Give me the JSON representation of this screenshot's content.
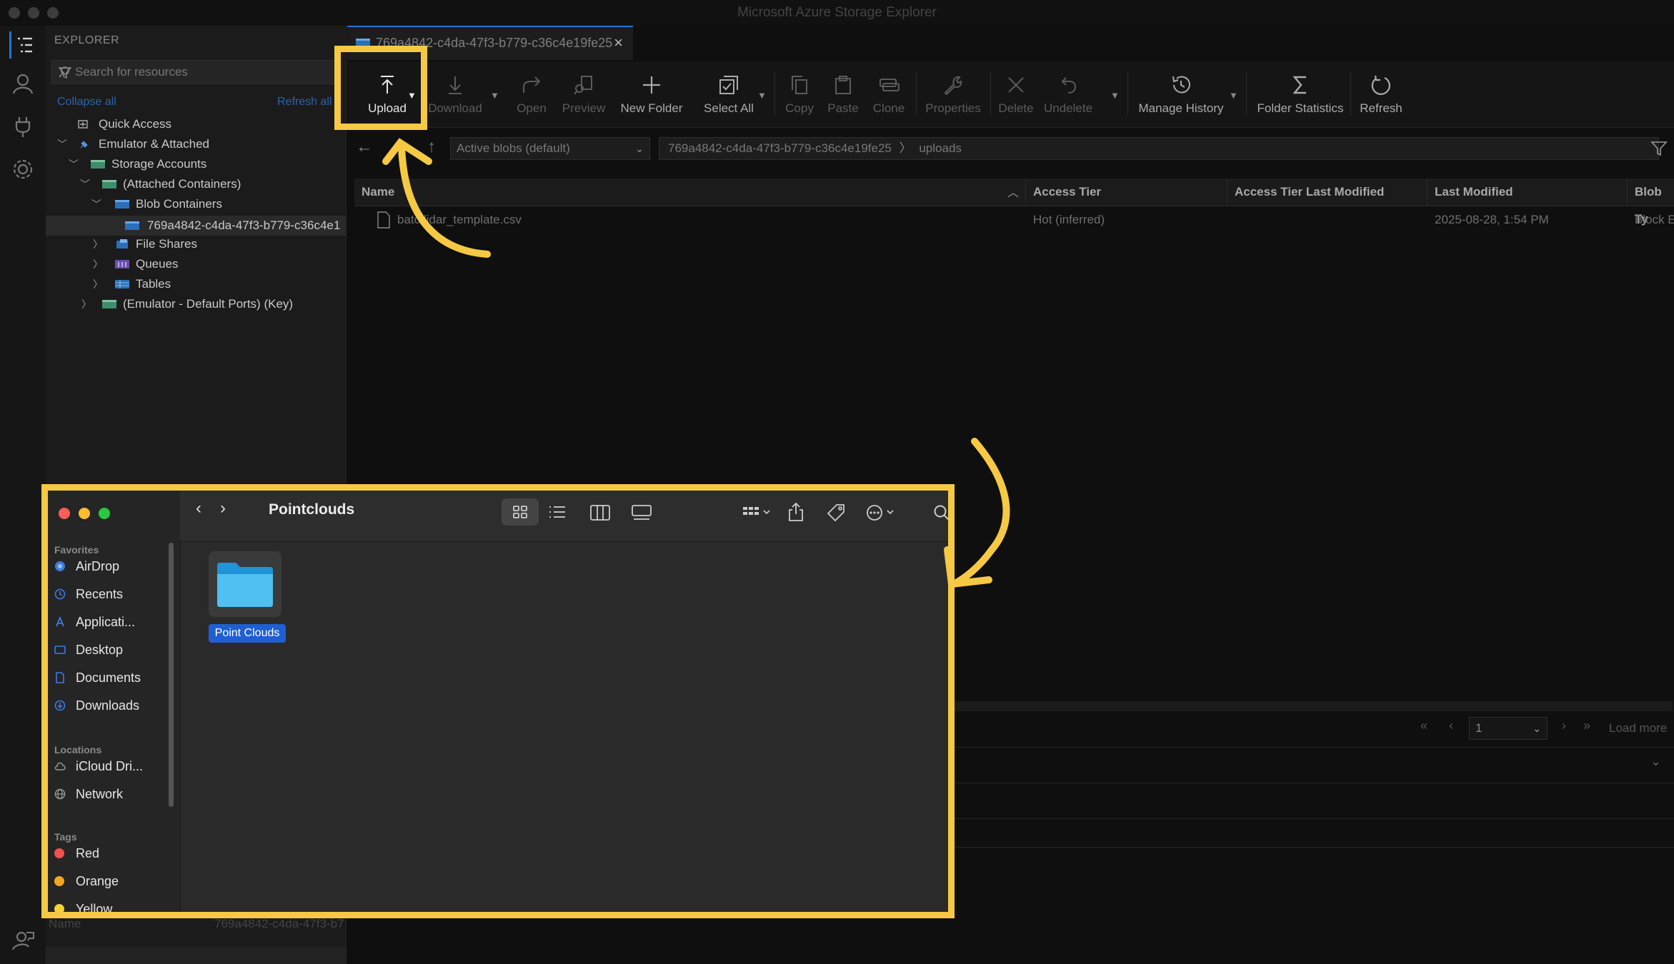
{
  "window": {
    "title": "Microsoft Azure Storage Explorer"
  },
  "explorer": {
    "title": "EXPLORER",
    "search_placeholder": "Search for resources",
    "collapse_all": "Collapse all",
    "refresh_all": "Refresh all",
    "tree": {
      "quick_access": "Quick Access",
      "emulator_attached": "Emulator & Attached",
      "storage_accounts": "Storage Accounts",
      "attached_containers": "(Attached Containers)",
      "blob_containers": "Blob Containers",
      "container_id": "769a4842-c4da-47f3-b779-c36c4e1",
      "file_shares": "File Shares",
      "queues": "Queues",
      "tables": "Tables",
      "emulator_default": "(Emulator - Default Ports) (Key)"
    },
    "bottom_name_label": "Name",
    "bottom_name_value": "769a4842-c4da-47f3-b7"
  },
  "tab": {
    "label": "769a4842-c4da-47f3-b779-c36c4e19fe25"
  },
  "toolbar": {
    "upload": "Upload",
    "download": "Download",
    "open": "Open",
    "preview": "Preview",
    "new_folder": "New Folder",
    "select_all": "Select All",
    "copy": "Copy",
    "paste": "Paste",
    "clone": "Clone",
    "properties": "Properties",
    "delete": "Delete",
    "undelete": "Undelete",
    "manage_history": "Manage History",
    "folder_statistics": "Folder Statistics",
    "refresh": "Refresh"
  },
  "navbar": {
    "view_mode": "Active blobs (default)",
    "breadcrumb_container": "769a4842-c4da-47f3-b779-c36c4e19fe25",
    "breadcrumb_folder": "uploads"
  },
  "grid": {
    "columns": [
      "Name",
      "Access Tier",
      "Access Tier Last Modified",
      "Last Modified",
      "Blob Ty"
    ],
    "rows": [
      {
        "name": "batc  lidar_template.csv",
        "access_tier": "Hot (inferred)",
        "tier_modified": "",
        "last_modified": "2025-08-28, 1:54 PM",
        "blob_type": "Block E"
      }
    ]
  },
  "pager": {
    "page": "1",
    "load_more": "Load more"
  },
  "finder": {
    "title": "Pointclouds",
    "sections": {
      "favorites": "Favorites",
      "locations": "Locations",
      "tags": "Tags"
    },
    "favorites": [
      "AirDrop",
      "Recents",
      "Applicati...",
      "Desktop",
      "Documents",
      "Downloads"
    ],
    "locations": [
      "iCloud Dri...",
      "Network"
    ],
    "tags": [
      "Red",
      "Orange",
      "Yellow"
    ],
    "folder": {
      "name": "Point Clouds"
    }
  },
  "colors": {
    "annotation": "#f6c944",
    "accent": "#2176d2",
    "selection": "#1f5fd1"
  }
}
